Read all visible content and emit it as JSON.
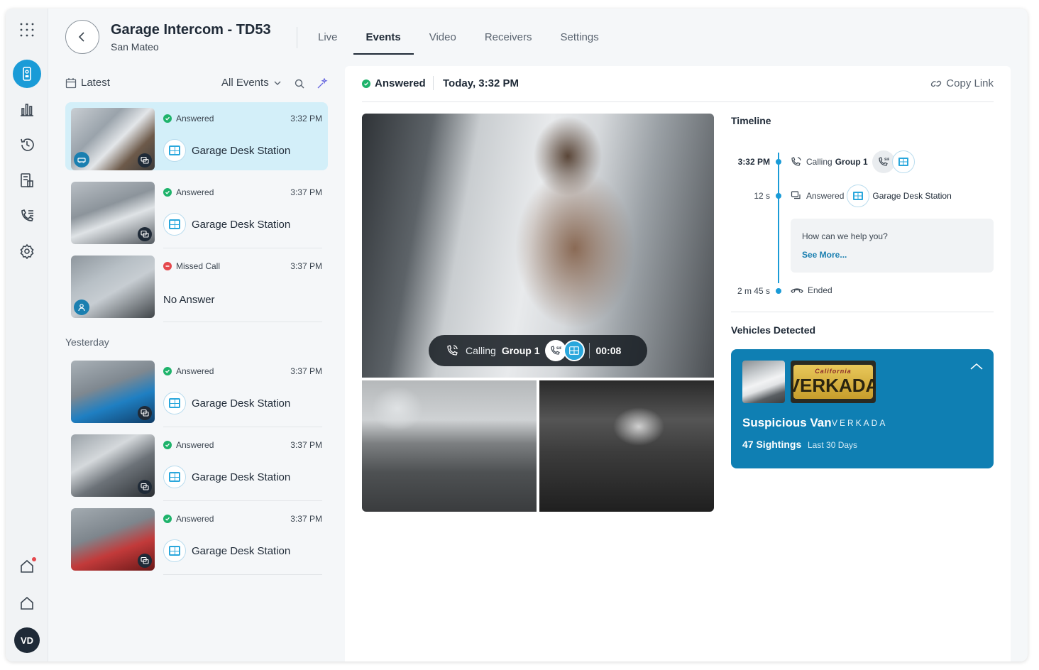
{
  "header": {
    "title": "Garage Intercom - TD53",
    "location": "San Mateo",
    "tabs": [
      {
        "label": "Live",
        "active": false
      },
      {
        "label": "Events",
        "active": true
      },
      {
        "label": "Video",
        "active": false
      },
      {
        "label": "Receivers",
        "active": false
      },
      {
        "label": "Settings",
        "active": false
      }
    ]
  },
  "rail": {
    "icons": [
      "apps-grid-icon",
      "intercom-icon",
      "analytics-icon",
      "history-icon",
      "reports-icon",
      "call-list-icon",
      "settings-icon",
      "home-alert-icon",
      "home-icon"
    ],
    "avatar_initials": "VD"
  },
  "list": {
    "latest_label": "Latest",
    "filter_label": "All Events",
    "yesterday_label": "Yesterday",
    "events": [
      {
        "status": "Answered",
        "status_type": "ok",
        "time": "3:32 PM",
        "destination": "Garage Desk Station",
        "selected": true
      },
      {
        "status": "Answered",
        "status_type": "ok",
        "time": "3:37 PM",
        "destination": "Garage Desk Station",
        "selected": false
      },
      {
        "status": "Missed Call",
        "status_type": "missed",
        "time": "3:37 PM",
        "destination": "No Answer",
        "selected": false
      },
      {
        "status": "Answered",
        "status_type": "ok",
        "time": "3:37 PM",
        "destination": "Garage Desk Station",
        "selected": false
      },
      {
        "status": "Answered",
        "status_type": "ok",
        "time": "3:37 PM",
        "destination": "Garage Desk Station",
        "selected": false
      },
      {
        "status": "Answered",
        "status_type": "ok",
        "time": "3:37 PM",
        "destination": "Garage Desk Station",
        "selected": false
      }
    ]
  },
  "detail": {
    "status": "Answered",
    "timestamp": "Today, 3:32 PM",
    "copy_link": "Copy Link",
    "call_overlay": {
      "label": "Calling",
      "group": "Group 1",
      "duration": "00:08"
    },
    "timeline": {
      "title": "Timeline",
      "entries": [
        {
          "time": "3:32 PM",
          "label": "Calling",
          "target": "Group 1"
        },
        {
          "time": "12 s",
          "label": "Answered",
          "target": "Garage Desk Station"
        },
        {
          "time": "2 m 45 s",
          "label": "Ended",
          "target": ""
        }
      ],
      "message": "How can we help you?",
      "see_more": "See More..."
    },
    "vehicles": {
      "title": "Vehicles Detected",
      "name": "Suspicious Van",
      "plate": "VERKADA",
      "plate_state": "California",
      "sightings": "47 Sightings",
      "period": "Last 30 Days"
    }
  },
  "colors": {
    "accent": "#1a9bd7",
    "selected_row": "#d3eff9",
    "answered": "#1eb36b",
    "missed": "#e5484d",
    "vehicle_card": "#0f7fb3"
  }
}
